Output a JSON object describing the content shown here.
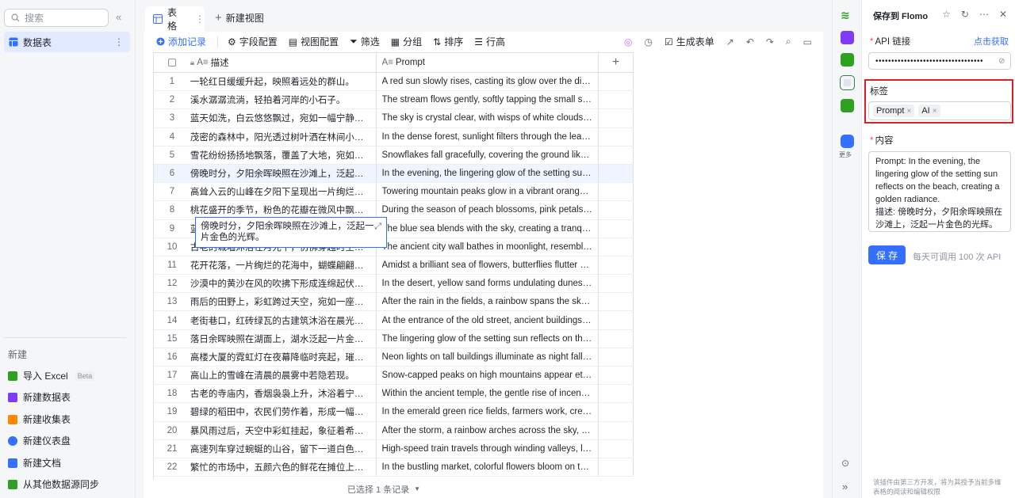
{
  "sidebar": {
    "search_placeholder": "搜索",
    "items": [
      {
        "label": "数据表"
      }
    ],
    "new_section_title": "新建",
    "new_items": [
      {
        "label": "导入 Excel",
        "badge": "Beta",
        "color": "#2ea121"
      },
      {
        "label": "新建数据表",
        "color": "#7f3bf5"
      },
      {
        "label": "新建收集表",
        "color": "#ff8800"
      },
      {
        "label": "新建仪表盘",
        "color": "#3370ff"
      },
      {
        "label": "新建文档",
        "color": "#3370ff"
      },
      {
        "label": "从其他数据源同步",
        "color": "#2ea121"
      }
    ]
  },
  "tabs": {
    "table_label": "表格",
    "new_view_label": "新建视图"
  },
  "toolbar": {
    "add_record": "添加记录",
    "field_config": "字段配置",
    "view_config": "视图配置",
    "filter": "筛选",
    "group": "分组",
    "sort": "排序",
    "row_height": "行高",
    "generate_form": "生成表单"
  },
  "grid": {
    "columns": {
      "desc": "描述",
      "prompt": "Prompt"
    },
    "rows": [
      {
        "n": "1",
        "desc": "一轮红日缓缓升起，映照着远处的群山。",
        "prompt": "A red sun slowly rises, casting its glow over the distant ..."
      },
      {
        "n": "2",
        "desc": "溪水潺潺流淌，轻拍着河岸的小石子。",
        "prompt": "The stream flows gently, softly tapping the small stones..."
      },
      {
        "n": "3",
        "desc": "蓝天如洗，白云悠悠飘过，宛如一幅宁静的画卷。",
        "prompt": "The sky is crystal clear, with wisps of white clouds drifti..."
      },
      {
        "n": "4",
        "desc": "茂密的森林中，阳光透过树叶洒在林间小径上。",
        "prompt": "In the dense forest, sunlight filters through the leaves, ..."
      },
      {
        "n": "5",
        "desc": "雪花纷纷扬扬地飘落，覆盖了大地，宛如银装素...",
        "prompt": "Snowflakes fall gracefully, covering the ground like a sil..."
      },
      {
        "n": "6",
        "desc": "傍晚时分，夕阳余晖映照在沙滩上，泛起一片金色的光辉。",
        "prompt": "In the evening, the lingering glow of the setting sun refl..."
      },
      {
        "n": "7",
        "desc": "高耸入云的山峰在夕阳下呈现出一片绚烂的橙色。",
        "prompt": "Towering mountain peaks glow in a vibrant orange hue ..."
      },
      {
        "n": "8",
        "desc": "桃花盛开的季节，粉色的花瓣在微风中飘舞。",
        "prompt": "During the season of peach blossoms, pink petals danc..."
      },
      {
        "n": "9",
        "desc": "蓝色的海水与天空相融，构成一幅宁静而辽阔的...",
        "prompt": "The blue sea blends with the sky, creating a tranquil an..."
      },
      {
        "n": "10",
        "desc": "古老的城墙沐浴在月光下，仿佛穿越时空的守护...",
        "prompt": "The ancient city wall bathes in moonlight, resembling a ..."
      },
      {
        "n": "11",
        "desc": "花开花落，一片绚烂的花海中，蝴蝶翩翩起舞。",
        "prompt": "Amidst a brilliant sea of flowers, butterflies flutter grace..."
      },
      {
        "n": "12",
        "desc": "沙漠中的黄沙在风的吹拂下形成连绵起伏的沙丘。",
        "prompt": "In the desert, yellow sand forms undulating dunes unde..."
      },
      {
        "n": "13",
        "desc": "雨后的田野上，彩虹跨过天空，宛如一座七彩的...",
        "prompt": "After the rain in the fields, a rainbow spans the sky, res..."
      },
      {
        "n": "14",
        "desc": "老街巷口，红砖绿瓦的古建筑沐浴在晨光中。",
        "prompt": "At the entrance of the old street, ancient buildings with ..."
      },
      {
        "n": "15",
        "desc": "落日余晖映照在湖面上，湖水泛起一片金色的涟...",
        "prompt": "The lingering glow of the setting sun reflects on the lak..."
      },
      {
        "n": "16",
        "desc": "高楼大厦的霓虹灯在夜幕降临时亮起，璀璨夺目。",
        "prompt": "Neon lights on tall buildings illuminate as night falls, da..."
      },
      {
        "n": "17",
        "desc": "高山上的雪峰在清晨的晨雾中若隐若现。",
        "prompt": "Snow-capped peaks on high mountains appear etherea..."
      },
      {
        "n": "18",
        "desc": "古老的寺庙内，香烟袅袅上升，沐浴着宁静的庙...",
        "prompt": "Within the ancient temple, the gentle rise of incense sm..."
      },
      {
        "n": "19",
        "desc": "碧绿的稻田中，农民们劳作着，形成一幅宁静的...",
        "prompt": "In the emerald green rice fields, farmers work, creating ..."
      },
      {
        "n": "20",
        "desc": "暴风雨过后，天空中彩虹挂起，象征着希望与美...",
        "prompt": "After the storm, a rainbow arches across the sky, symb..."
      },
      {
        "n": "21",
        "desc": "高速列车穿过蜿蜒的山谷，留下一道白色的痕迹。",
        "prompt": "High-speed train travels through winding valleys, leavin..."
      },
      {
        "n": "22",
        "desc": "繁忙的市场中，五颜六色的鲜花在摊位上绽放。",
        "prompt": "In the bustling market, colorful flowers bloom on the st..."
      }
    ],
    "editing_text": "傍晚时分，夕阳余晖映照在沙滩上，泛起一片金色的光辉。",
    "footer": "已选择 1 条记录"
  },
  "plugin_strip": {
    "more_label": "更多"
  },
  "panel": {
    "title": "保存到 Flomo",
    "api_label": "API 链接",
    "get_link": "点击获取",
    "api_value": "••••••••••••••••••••••••••••••••••",
    "tags_label": "标签",
    "tags": [
      "Prompt",
      "AI"
    ],
    "content_label": "内容",
    "content_text": "Prompt: In the evening, the lingering glow of the setting sun reflects on the beach, creating a golden radiance.\n描述: 傍晚时分，夕阳余晖映照在沙滩上，泛起一片金色的光辉。",
    "save_label": "保 存",
    "quota_text": "每天可调用 100 次 API",
    "disclaimer": "该插件由第三方开发，将为其授予当前多维表格的阅读和编辑权限"
  }
}
